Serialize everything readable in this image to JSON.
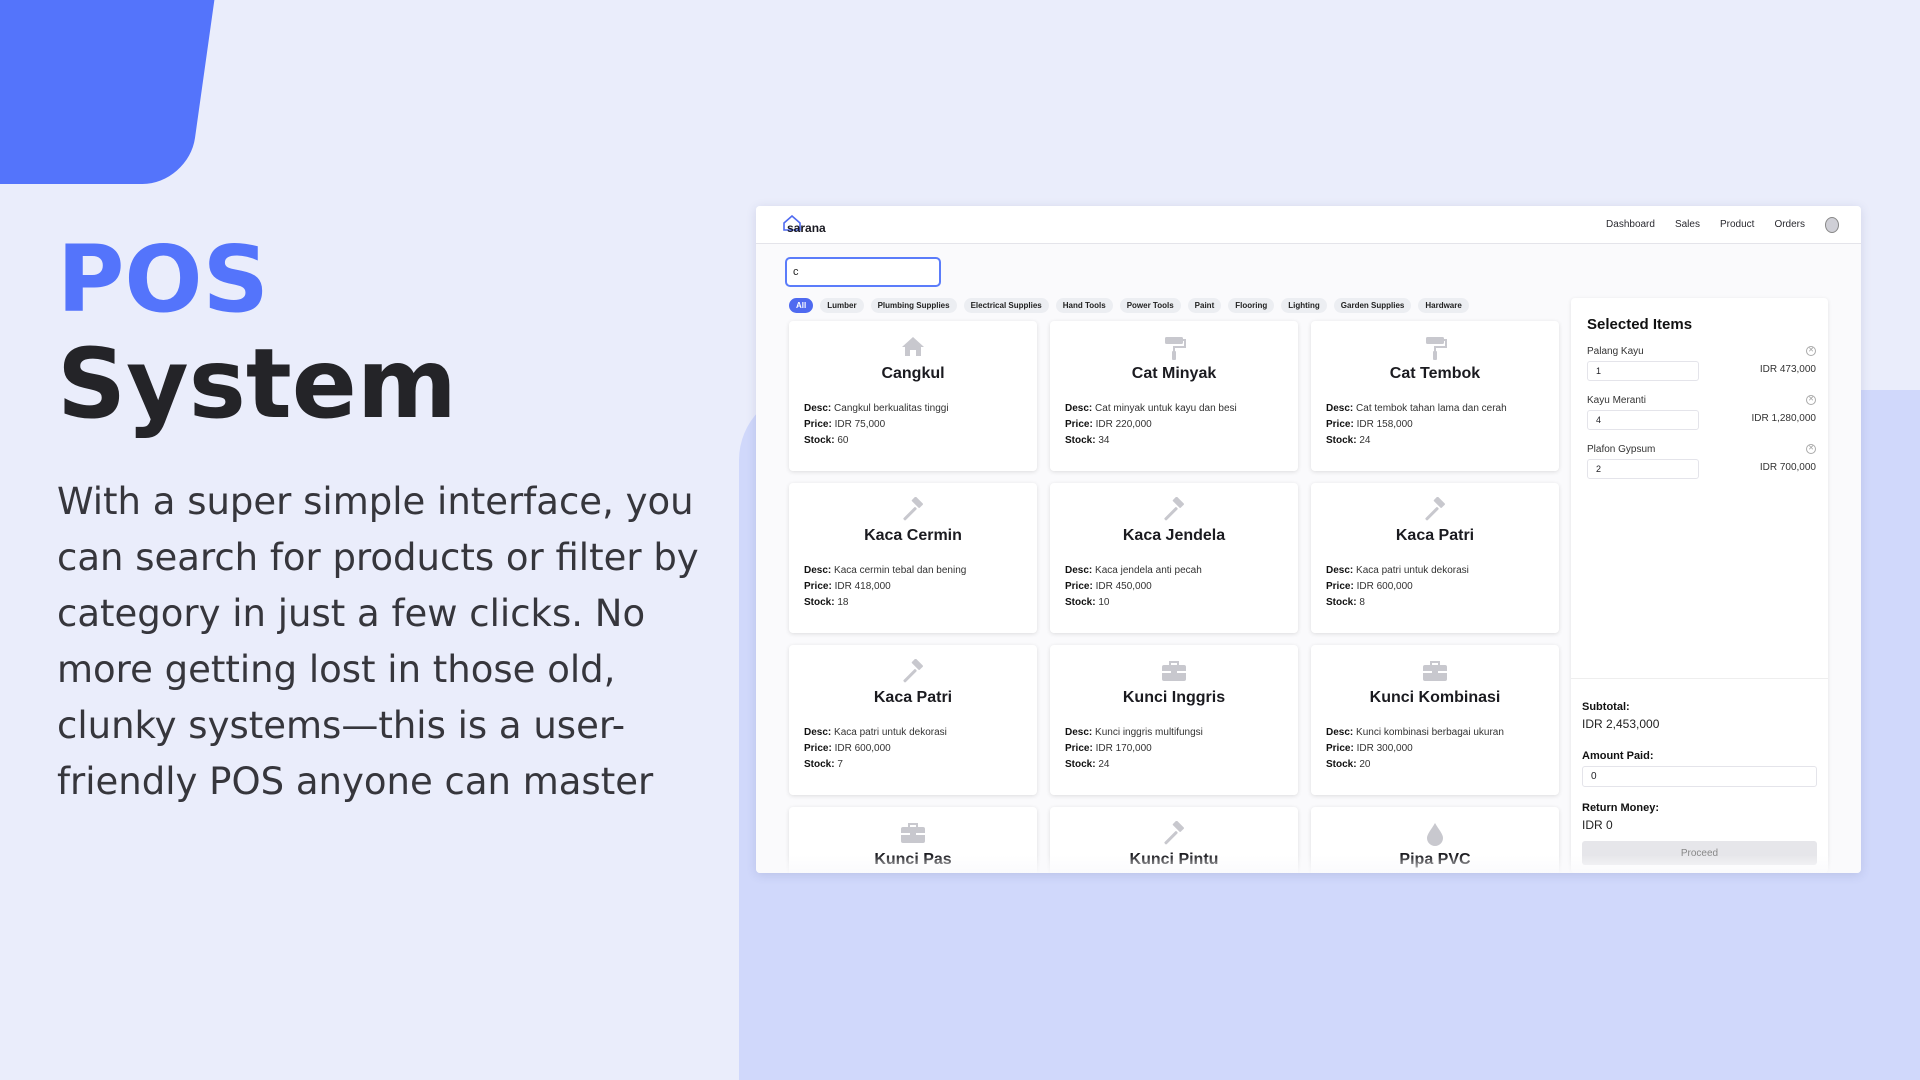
{
  "hero": {
    "title_line1": "POS",
    "title_line2": "System",
    "body": "With a super simple interface, you can search for products or filter by category in just a few clicks. No more getting lost in those old, clunky systems—this is a user-friendly POS anyone can master"
  },
  "app": {
    "logo": "sarana",
    "nav": [
      "Dashboard",
      "Sales",
      "Product",
      "Orders"
    ],
    "search_value": "c",
    "categories": [
      "All",
      "Lumber",
      "Plumbing Supplies",
      "Electrical Supplies",
      "Hand Tools",
      "Power Tools",
      "Paint",
      "Flooring",
      "Lighting",
      "Garden Supplies",
      "Hardware"
    ],
    "active_category": "All",
    "labels": {
      "desc": "Desc:",
      "price": "Price:",
      "stock": "Stock:"
    },
    "products": [
      {
        "name": "Cangkul",
        "icon": "house-icon",
        "desc": "Cangkul berkualitas tinggi",
        "price": "IDR 75,000",
        "stock": "60"
      },
      {
        "name": "Cat Minyak",
        "icon": "paint-roller-icon",
        "desc": "Cat minyak untuk kayu dan besi",
        "price": "IDR 220,000",
        "stock": "34"
      },
      {
        "name": "Cat Tembok",
        "icon": "paint-roller-icon",
        "desc": "Cat tembok tahan lama dan cerah",
        "price": "IDR 158,000",
        "stock": "24"
      },
      {
        "name": "Kaca Cermin",
        "icon": "hammer-icon",
        "desc": "Kaca cermin tebal dan bening",
        "price": "IDR 418,000",
        "stock": "18"
      },
      {
        "name": "Kaca Jendela",
        "icon": "hammer-icon",
        "desc": "Kaca jendela anti pecah",
        "price": "IDR 450,000",
        "stock": "10"
      },
      {
        "name": "Kaca Patri",
        "icon": "hammer-icon",
        "desc": "Kaca patri untuk dekorasi",
        "price": "IDR 600,000",
        "stock": "8"
      },
      {
        "name": "Kaca Patri",
        "icon": "hammer-icon",
        "desc": "Kaca patri untuk dekorasi",
        "price": "IDR 600,000",
        "stock": "7"
      },
      {
        "name": "Kunci Inggris",
        "icon": "toolbox-icon",
        "desc": "Kunci inggris multifungsi",
        "price": "IDR 170,000",
        "stock": "24"
      },
      {
        "name": "Kunci Kombinasi",
        "icon": "toolbox-icon",
        "desc": "Kunci kombinasi berbagai ukuran",
        "price": "IDR 300,000",
        "stock": "20"
      },
      {
        "name": "Kunci Pas",
        "icon": "toolbox-icon"
      },
      {
        "name": "Kunci Pintu",
        "icon": "hammer-icon"
      },
      {
        "name": "Pipa PVC",
        "icon": "droplet-icon"
      }
    ],
    "selected": {
      "title": "Selected Items",
      "items": [
        {
          "name": "Palang Kayu",
          "qty": "1",
          "price": "IDR 473,000"
        },
        {
          "name": "Kayu Meranti",
          "qty": "4",
          "price": "IDR 1,280,000"
        },
        {
          "name": "Plafon Gypsum",
          "qty": "2",
          "price": "IDR 700,000"
        }
      ],
      "subtotal_label": "Subtotal:",
      "subtotal": "IDR 2,453,000",
      "paid_label": "Amount Paid:",
      "paid_value": "0",
      "return_label": "Return Money:",
      "return_value": "IDR 0",
      "proceed": "Proceed"
    }
  },
  "colors": {
    "accent": "#5474fb",
    "panel": "#d0d8fb",
    "background": "#eaedfb"
  }
}
